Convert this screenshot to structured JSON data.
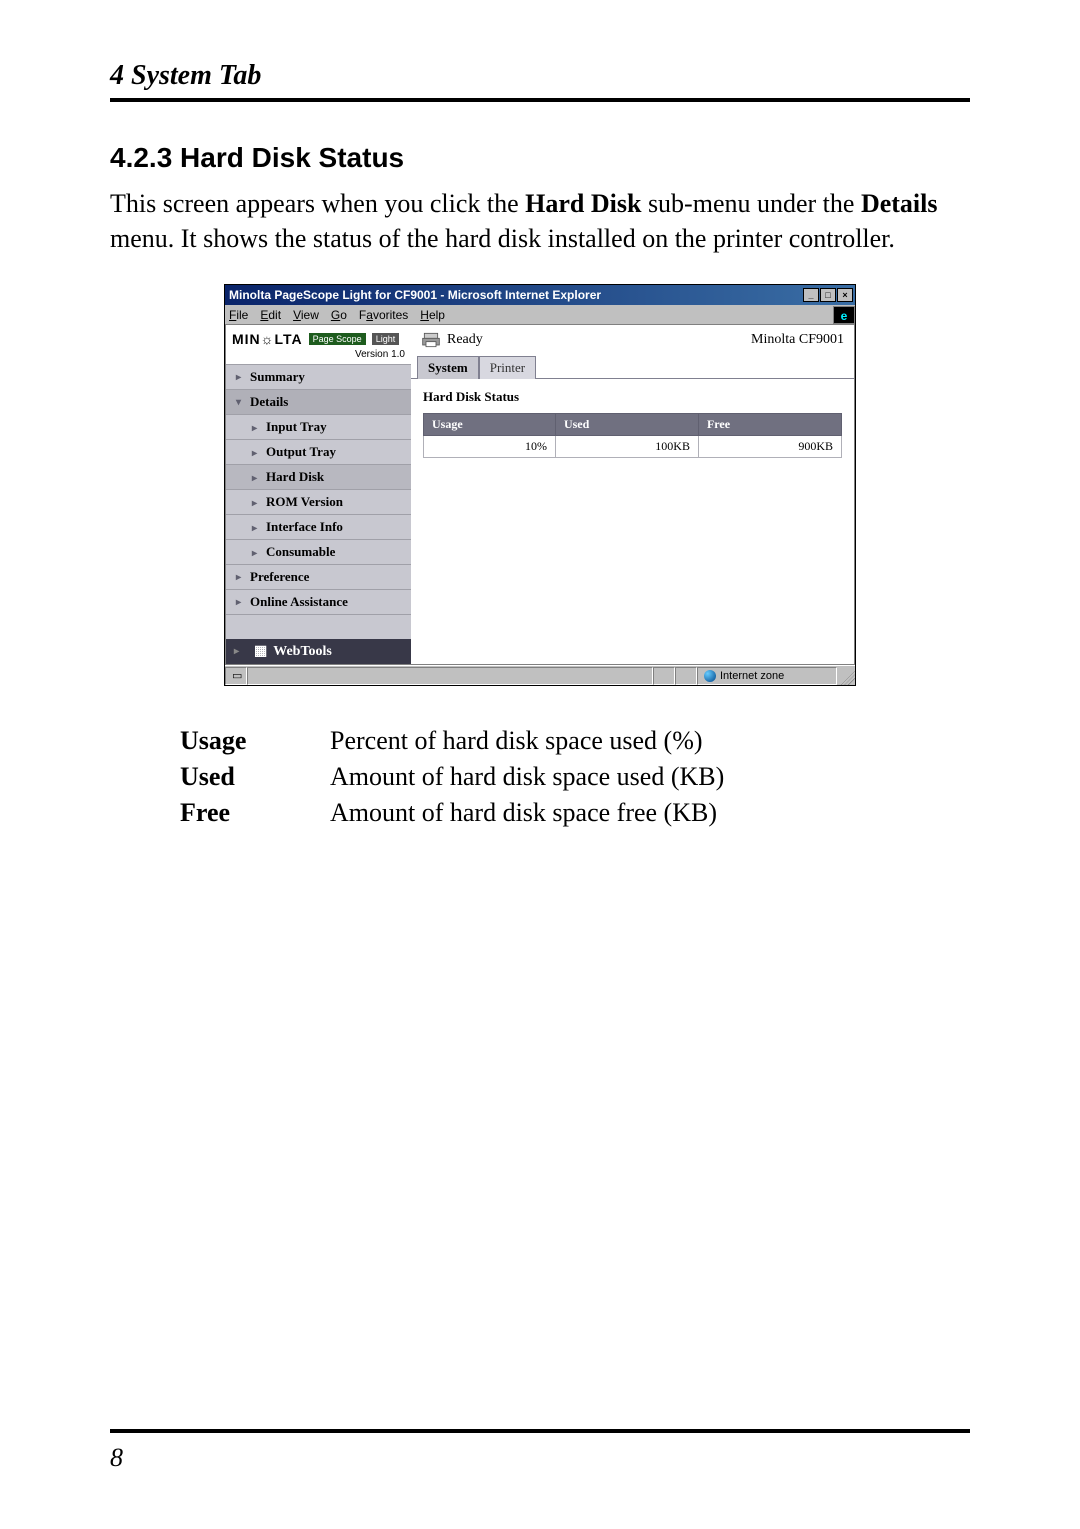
{
  "chapter_header": "4  System Tab",
  "section_title": "4.2.3   Hard Disk Status",
  "body_text_1": "This screen appears when you click the ",
  "body_bold_1": "Hard Disk",
  "body_text_2": " sub-menu under the ",
  "body_bold_2": "Details",
  "body_text_3": " menu. It shows the status of the hard disk installed on the printer controller.",
  "screenshot": {
    "window_title": "Minolta PageScope Light for CF9001 - Microsoft Internet Explorer",
    "menu": {
      "file": "File",
      "edit": "Edit",
      "view": "View",
      "go": "Go",
      "favorites": "Favorites",
      "help": "Help"
    },
    "sidebar": {
      "brand": "MIN☼LTA",
      "pagescope": "Page Scope",
      "light": "Light",
      "version": "Version 1.0",
      "items": [
        {
          "label": "Summary"
        },
        {
          "label": "Details"
        },
        {
          "label": "Input Tray"
        },
        {
          "label": "Output Tray"
        },
        {
          "label": "Hard Disk"
        },
        {
          "label": "ROM Version"
        },
        {
          "label": "Interface Info"
        },
        {
          "label": "Consumable"
        },
        {
          "label": "Preference"
        },
        {
          "label": "Online Assistance"
        }
      ],
      "webtools": "WebTools"
    },
    "header": {
      "ready": "Ready",
      "model": "Minolta CF9001"
    },
    "tabs": {
      "system": "System",
      "printer": "Printer"
    },
    "pane_title": "Hard Disk Status",
    "table": {
      "th_usage": "Usage",
      "th_used": "Used",
      "th_free": "Free",
      "val_usage": "10%",
      "val_used": "100KB",
      "val_free": "900KB"
    },
    "status_zone": "Internet zone"
  },
  "defs": [
    {
      "term": "Usage",
      "desc": "Percent of hard disk space used (%)"
    },
    {
      "term": "Used",
      "desc": "Amount of hard disk space used (KB)"
    },
    {
      "term": "Free",
      "desc": "Amount of hard disk space free (KB)"
    }
  ],
  "page_number": "8"
}
